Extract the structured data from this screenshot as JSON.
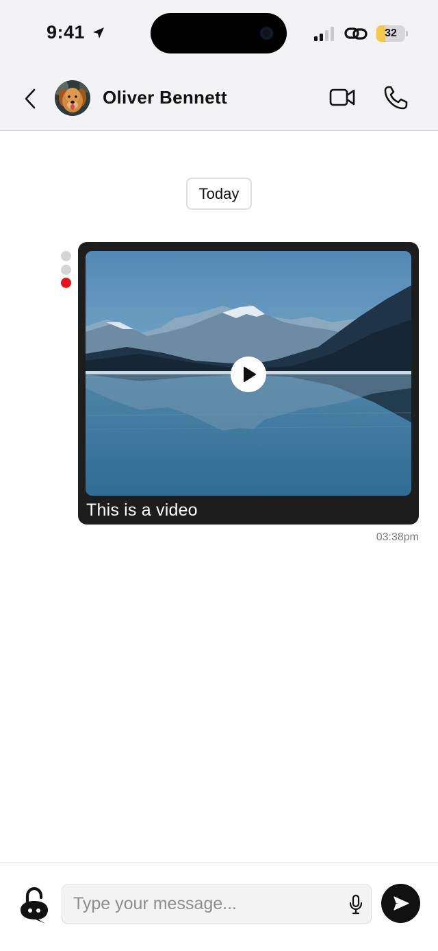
{
  "status_bar": {
    "time": "9:41",
    "battery_level": "32",
    "battery_fraction": 0.32,
    "battery_color": "#f4c84a"
  },
  "header": {
    "contact_name": "Oliver Bennett",
    "icons": {
      "back": "chevron-left-icon",
      "video": "video-camera-icon",
      "call": "phone-icon"
    }
  },
  "chat": {
    "date_separator": "Today",
    "messages": [
      {
        "type": "video",
        "caption": "This is a video",
        "time": "03:38pm",
        "status_dot_color": "#e8101b"
      }
    ]
  },
  "composer": {
    "placeholder": "Type your message...",
    "value": "",
    "icons": {
      "assistant": "bot-lock-icon",
      "mic": "microphone-icon",
      "send": "send-icon"
    }
  }
}
